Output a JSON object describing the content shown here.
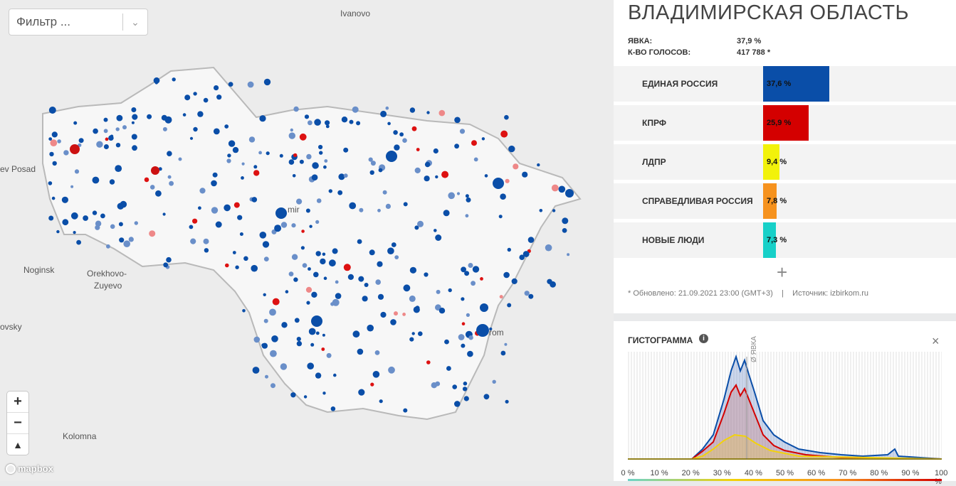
{
  "filter": {
    "placeholder": "Фильтр ...",
    "chevron_icon": "chevron-down-icon"
  },
  "map": {
    "cities": [
      "Ivanovo",
      "ev Posad",
      "Noginsk",
      "Orekhovo-",
      "Zuyevo",
      "ovsky",
      "Kolomna",
      "mir",
      "rom"
    ],
    "zoom": {
      "in": "+",
      "out": "−",
      "compass": "▲"
    },
    "attribution": "mapbox"
  },
  "region": {
    "title": "ВЛАДИМИРСКАЯ ОБЛАСТЬ",
    "turnout_label": "ЯВКА:",
    "turnout_value": "37,9 %",
    "votes_label": "К-ВО ГОЛОСОВ:",
    "votes_value": "417 788 *"
  },
  "parties": [
    {
      "name": "ЕДИНАЯ РОССИЯ",
      "pct": "37,6 %",
      "value": 37.6,
      "color": "#0a4ea8"
    },
    {
      "name": "КПРФ",
      "pct": "25,9 %",
      "value": 25.9,
      "color": "#d40000"
    },
    {
      "name": "ЛДПР",
      "pct": "9,4 %",
      "value": 9.4,
      "color": "#f2f20a"
    },
    {
      "name": "СПРАВЕДЛИВАЯ РОССИЯ",
      "pct": "7,8 %",
      "value": 7.8,
      "color": "#f6921e"
    },
    {
      "name": "НОВЫЕ ЛЮДИ",
      "pct": "7,3 %",
      "value": 7.3,
      "color": "#17d0c8"
    }
  ],
  "more": "+",
  "footer": {
    "updated": "* Обновлено: 21.09.2021 23:00 (GMT+3)",
    "sep": "|",
    "source": "Источник: izbirkom.ru"
  },
  "histogram": {
    "title": "ГИСТОГРАММА",
    "info_icon": "i",
    "close_icon": "×",
    "marker_label": "Ø ЯВКА",
    "ticks": [
      "0 %",
      "10 %",
      "20 %",
      "30 %",
      "40 %",
      "50 %",
      "60 %",
      "70 %",
      "80 %",
      "90 %",
      "100 %"
    ]
  }
}
